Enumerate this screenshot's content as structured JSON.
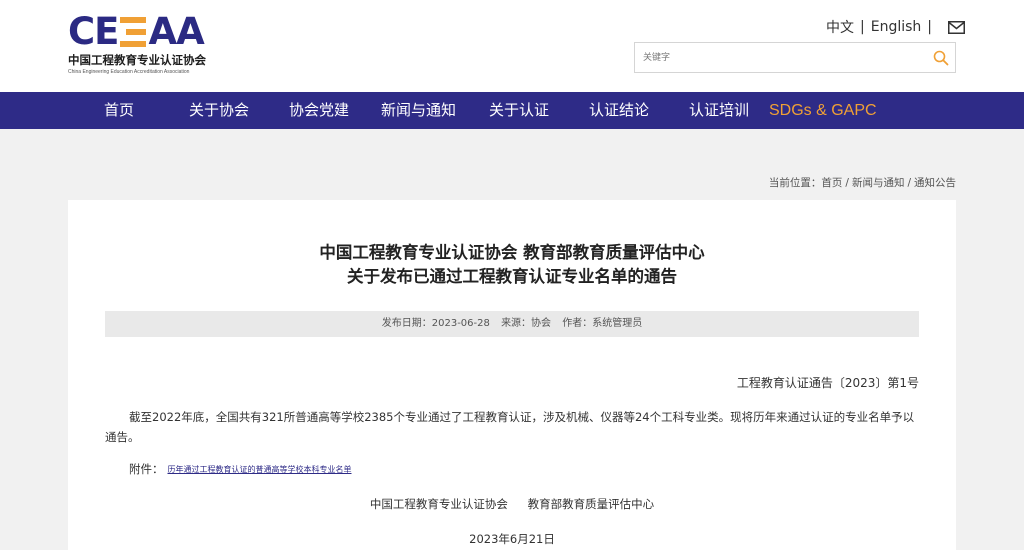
{
  "header": {
    "logo": {
      "mark_letters": [
        "C",
        "E",
        "E",
        "A",
        "A"
      ],
      "name_cn": "中国工程教育专业认证协会",
      "name_en": "China Engineering Education Accreditation Association"
    },
    "lang": {
      "chinese": "中文",
      "separator": "|",
      "english": "English",
      "mail_icon": "mail-icon"
    },
    "search": {
      "placeholder": "关键字",
      "icon": "search-icon"
    }
  },
  "nav": {
    "items": [
      {
        "label": "首页"
      },
      {
        "label": "关于协会"
      },
      {
        "label": "协会党建"
      },
      {
        "label": "新闻与通知"
      },
      {
        "label": "关于认证"
      },
      {
        "label": "认证结论"
      },
      {
        "label": "认证培训"
      },
      {
        "label": "SDGs & GAPC"
      }
    ],
    "highlight_color": "#f0a035",
    "bg_color": "#2e2b87"
  },
  "breadcrumb": {
    "prefix": "当前位置：",
    "items": [
      "首页",
      "新闻与通知",
      "通知公告"
    ],
    "separator": "/"
  },
  "article": {
    "title_line1": "中国工程教育专业认证协会  教育部教育质量评估中心",
    "title_line2": "关于发布已通过工程教育认证专业名单的通告",
    "meta": {
      "date": "发布日期：2023-06-28",
      "source": "来源：协会",
      "author": "作者：系统管理员"
    },
    "doc_number": "工程教育认证通告〔2023〕第1号",
    "paragraph": "截至2022年底，全国共有321所普通高等学校2385个专业通过了工程教育认证，涉及机械、仪器等24个工科专业类。现将历年来通过认证的专业名单予以通告。",
    "attachment_label": "附件：",
    "attachment_link": "历年通过工程教育认证的普通高等学校本科专业名单",
    "signer1": "中国工程教育专业认证协会",
    "signer2": "教育部教育质量评估中心",
    "date": "2023年6月21日"
  }
}
